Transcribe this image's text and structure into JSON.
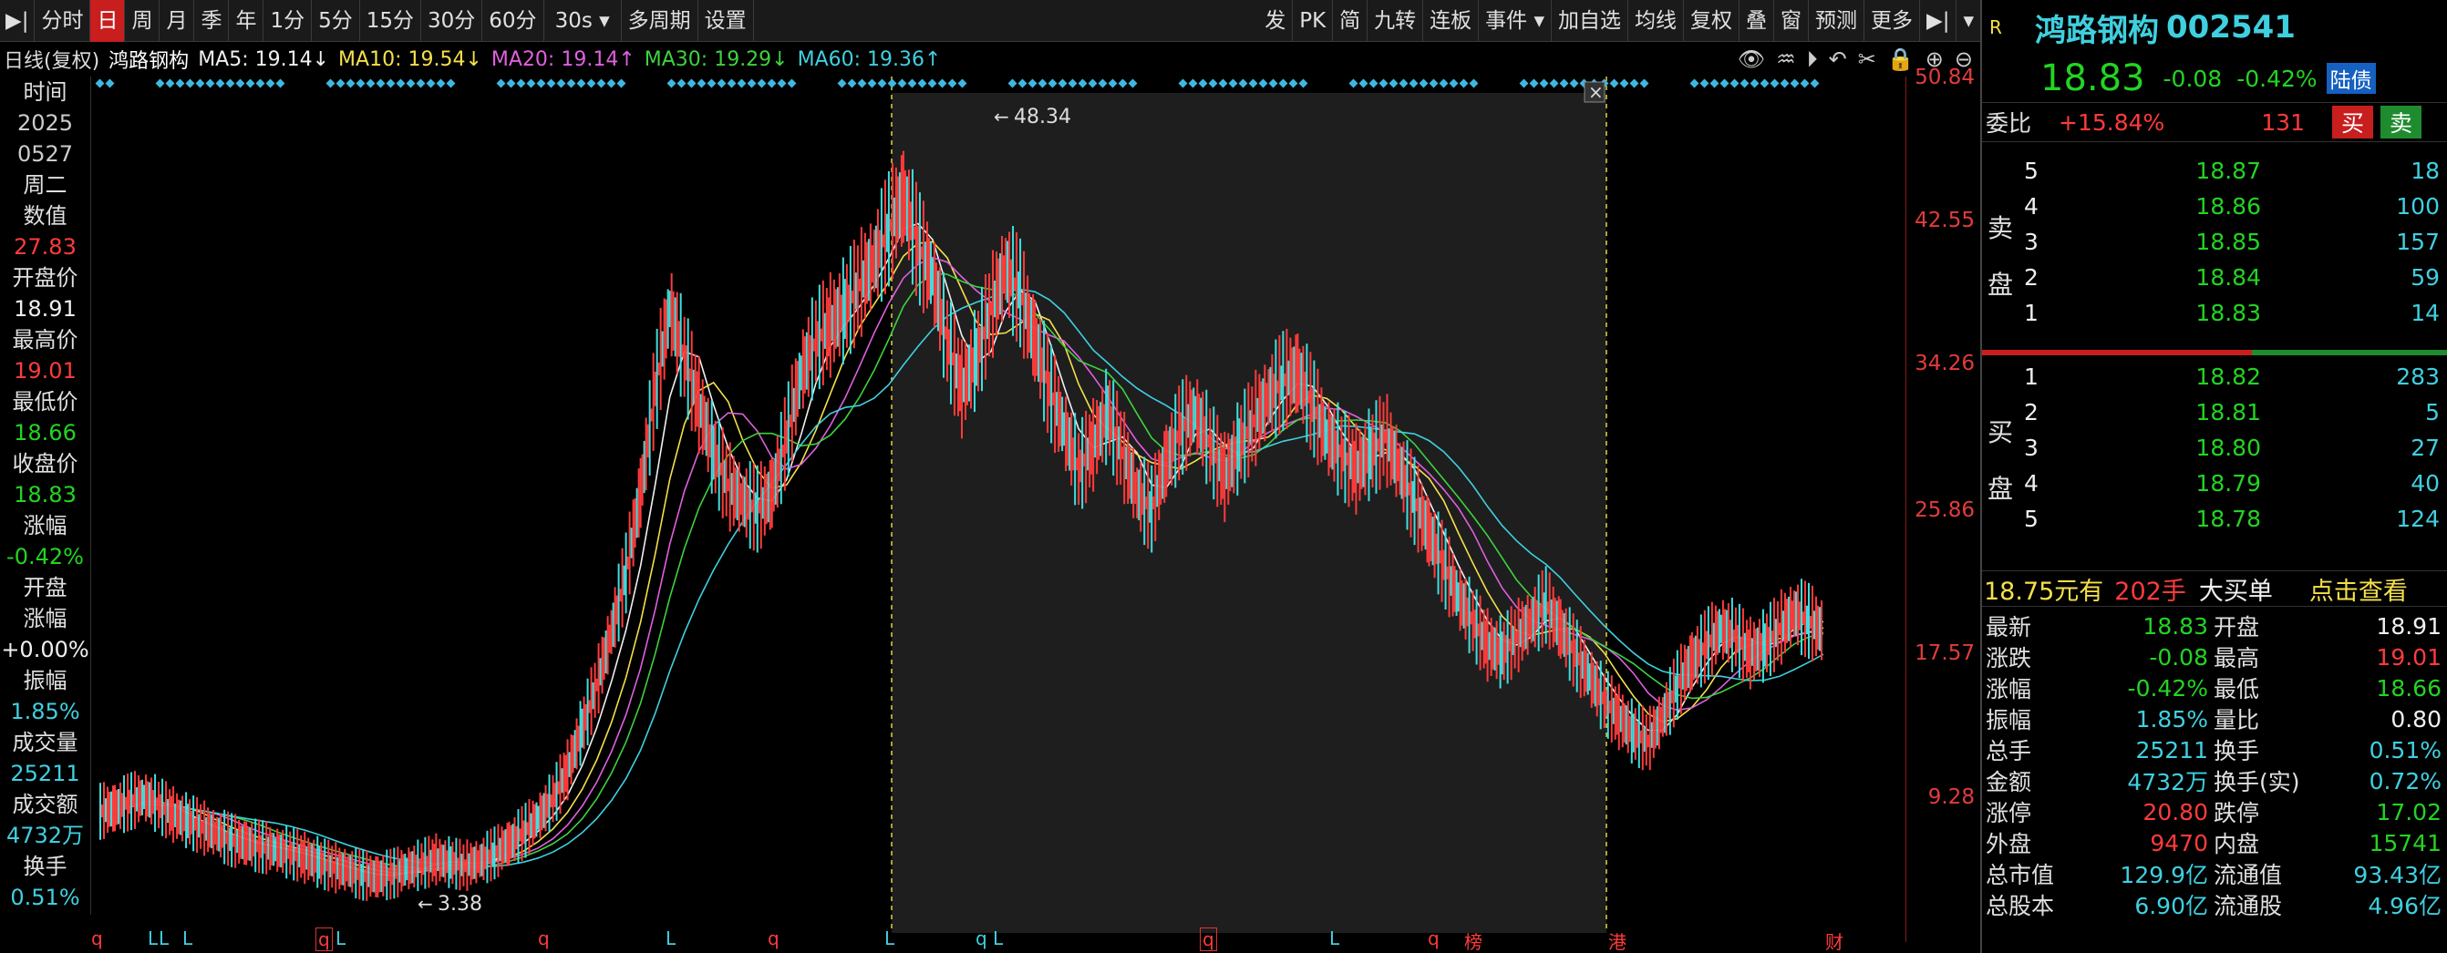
{
  "toolbar": {
    "left": [
      "分时",
      "日",
      "周",
      "月",
      "季",
      "年",
      "1分",
      "5分",
      "15分",
      "30分",
      "60分",
      "30s ▾",
      "多周期",
      "设置"
    ],
    "active_index": 1,
    "right": [
      "发",
      "PK",
      "简",
      "九转",
      "连板",
      "事件 ▾",
      "加自选",
      "均线",
      "复权",
      "叠",
      "窗",
      "预测",
      "更多"
    ]
  },
  "ma": {
    "period": "日线(复权)",
    "stock": "鸿路钢构",
    "ma5": "MA5: 19.14↓",
    "ma10": "MA10: 19.54↓",
    "ma20": "MA20: 19.14↑",
    "ma30": "MA30: 19.29↓",
    "ma60": "MA60: 19.36↑"
  },
  "left_info": {
    "time_label": "时间",
    "year": "2025",
    "date": "0527",
    "weekday": "周二",
    "value_label": "数值",
    "value": "27.83",
    "open_label": "开盘价",
    "open": "18.91",
    "high_label": "最高价",
    "high": "19.01",
    "low_label": "最低价",
    "low": "18.66",
    "close_label": "收盘价",
    "close": "18.83",
    "chg_label": "涨幅",
    "chg": "-0.42%",
    "open_chg_label1": "开盘",
    "open_chg_label2": "涨幅",
    "open_chg": "+0.00%",
    "amp_label": "振幅",
    "amp": "1.85%",
    "vol_label": "成交量",
    "vol": "25211",
    "amt_label": "成交额",
    "amt": "4732万",
    "turn_label": "换手",
    "turn": "0.51%"
  },
  "yaxis": [
    "50.84",
    "42.55",
    "34.26",
    "25.86",
    "17.57",
    "9.28"
  ],
  "annotations": {
    "high": "48.34",
    "low": "3.38"
  },
  "chart_data": {
    "type": "line",
    "title": "",
    "series": [
      {
        "name": "",
        "values": [
          7.6,
          7.8,
          8.2,
          8.5,
          8.0,
          7.4,
          7.0,
          6.6,
          6.2,
          5.8,
          5.6,
          5.4,
          5.2,
          5.0,
          4.7,
          4.4,
          4.1,
          3.9,
          3.6,
          3.5,
          3.7,
          4.0,
          4.3,
          4.6,
          4.4,
          4.2,
          4.5,
          5.0,
          5.6,
          6.3,
          7.2,
          8.4,
          10.2,
          12.8,
          15.5,
          18.8,
          22.5,
          27.5,
          34.0,
          39.0,
          36.0,
          33.0,
          30.0,
          28.0,
          27.0,
          26.5,
          27.5,
          31.0,
          35.0,
          37.0,
          38.0,
          39.0,
          40.5,
          42.0,
          44.0,
          46.0,
          43.0,
          41.0,
          37.0,
          34.0,
          36.0,
          39.0,
          41.5,
          40.0,
          37.0,
          34.0,
          31.5,
          29.0,
          30.5,
          32.5,
          30.0,
          27.5,
          26.5,
          29.5,
          31.5,
          32.5,
          30.5,
          28.5,
          30.5,
          32.0,
          33.5,
          34.5,
          35.0,
          33.0,
          31.0,
          30.0,
          29.0,
          30.0,
          31.0,
          29.0,
          27.0,
          25.0,
          23.0,
          21.0,
          19.5,
          18.0,
          17.5,
          18.5,
          19.5,
          20.5,
          19.0,
          17.5,
          16.0,
          14.5,
          13.5,
          12.5,
          12.0,
          13.5,
          15.5,
          17.0,
          18.0,
          19.0,
          18.5,
          17.5,
          18.0,
          19.0,
          20.0,
          19.5,
          18.83
        ]
      },
      {
        "name": "MA5",
        "values": []
      }
    ],
    "ylim": [
      0,
      52.5
    ],
    "grid": false,
    "xlabel": "",
    "ylabel": ""
  },
  "bottom_marks": [
    "q",
    "L",
    "L",
    "L",
    "q",
    "L",
    "q",
    "L",
    "q",
    "L",
    "q L",
    "q",
    "L",
    "q",
    "榜",
    "港",
    "财"
  ],
  "right": {
    "badge": "R",
    "name": "鸿路钢构",
    "code": "002541",
    "price": "18.83",
    "change": "-0.08",
    "change_pct": "-0.42%",
    "tag": "陆债",
    "weibi_label": "委比",
    "weibi": "+15.84%",
    "weicha": "131",
    "buy_btn": "买",
    "sell_btn": "卖",
    "sell_label": "卖盘",
    "buy_label": "买盘",
    "asks": [
      {
        "lv": "5",
        "price": "18.87",
        "vol": "18"
      },
      {
        "lv": "4",
        "price": "18.86",
        "vol": "100"
      },
      {
        "lv": "3",
        "price": "18.85",
        "vol": "157"
      },
      {
        "lv": "2",
        "price": "18.84",
        "vol": "59"
      },
      {
        "lv": "1",
        "price": "18.83",
        "vol": "14"
      }
    ],
    "bids": [
      {
        "lv": "1",
        "price": "18.82",
        "vol": "283"
      },
      {
        "lv": "2",
        "price": "18.81",
        "vol": "5"
      },
      {
        "lv": "3",
        "price": "18.80",
        "vol": "27"
      },
      {
        "lv": "4",
        "price": "18.79",
        "vol": "40"
      },
      {
        "lv": "5",
        "price": "18.78",
        "vol": "124"
      }
    ],
    "big_order": {
      "price": "18.75元有",
      "qty": "202手",
      "text": "大买单",
      "link": "点击查看"
    },
    "stats": [
      {
        "k1": "最新",
        "v1": "18.83",
        "c1": "green",
        "k2": "开盘",
        "v2": "18.91",
        "c2": "white"
      },
      {
        "k1": "涨跌",
        "v1": "-0.08",
        "c1": "green",
        "k2": "最高",
        "v2": "19.01",
        "c2": "red"
      },
      {
        "k1": "涨幅",
        "v1": "-0.42%",
        "c1": "green",
        "k2": "最低",
        "v2": "18.66",
        "c2": "green"
      },
      {
        "k1": "振幅",
        "v1": "1.85%",
        "c1": "cyan",
        "k2": "量比",
        "v2": "0.80",
        "c2": "white"
      },
      {
        "k1": "总手",
        "v1": "25211",
        "c1": "cyan",
        "k2": "换手",
        "v2": "0.51%",
        "c2": "cyan"
      },
      {
        "k1": "金额",
        "v1": "4732万",
        "c1": "cyan",
        "k2": "换手(实)",
        "v2": "0.72%",
        "c2": "cyan"
      },
      {
        "k1": "涨停",
        "v1": "20.80",
        "c1": "red",
        "k2": "跌停",
        "v2": "17.02",
        "c2": "green"
      },
      {
        "k1": "外盘",
        "v1": "9470",
        "c1": "red",
        "k2": "内盘",
        "v2": "15741",
        "c2": "green"
      },
      {
        "k1": "总市值",
        "v1": "129.9亿",
        "c1": "cyan",
        "k2": "流通值",
        "v2": "93.43亿",
        "c2": "cyan"
      },
      {
        "k1": "总股本",
        "v1": "6.90亿",
        "c1": "cyan",
        "k2": "流通股",
        "v2": "4.96亿",
        "c2": "cyan"
      }
    ]
  }
}
